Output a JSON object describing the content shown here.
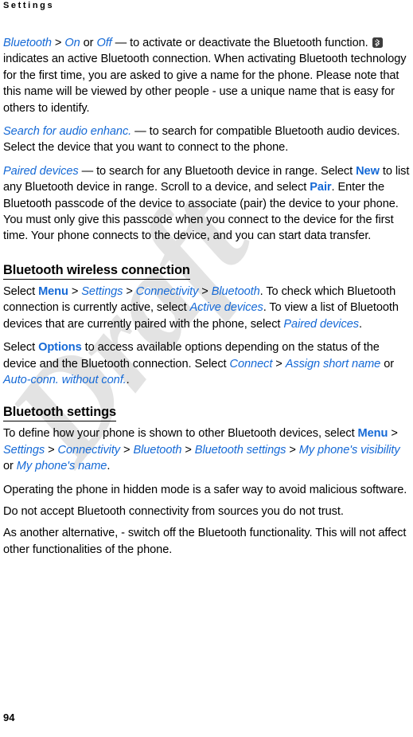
{
  "page": {
    "running_header": "Settings",
    "folio": "94",
    "watermark": "Draft",
    "accent_color": "#1569d6",
    "text_color": "#000000",
    "background_color": "#ffffff",
    "watermark_color": "#e3e3e3"
  },
  "content": {
    "para_bluetooth_onoff": {
      "term": "Bluetooth",
      "sep1": " > ",
      "opt_on": "On",
      "mid_or": " or ",
      "opt_off": "Off",
      "text_a": " — to activate or deactivate the Bluetooth function. ",
      "icon": "bluetooth-icon",
      "text_b": " indicates an active Bluetooth connection. When activating Bluetooth technology for the first time, you are asked to give a name for the phone. Please note that this name will be viewed by other people - use a unique name that is easy for others to identify."
    },
    "para_search_audio": {
      "term": "Search for audio enhanc.",
      "text": " — to search for compatible Bluetooth audio devices. Select the device that you want to connect to the phone."
    },
    "para_paired_devices": {
      "term": "Paired devices",
      "text_a": " — to search for any Bluetooth device in range. Select ",
      "btn_new": "New",
      "text_b": " to list any Bluetooth device in range. Scroll to a device, and select ",
      "btn_pair": "Pair",
      "text_c": ". Enter the Bluetooth passcode of the device to associate (pair) the device to your phone. You must only give this passcode when you connect to the device for the first time. Your phone connects to the device, and you can start data transfer."
    },
    "heading_wireless_connection": "Bluetooth wireless connection",
    "para_select_path": {
      "lead": "Select ",
      "menu": "Menu",
      "sep1": " > ",
      "settings": "Settings",
      "sep2": " > ",
      "connectivity": "Connectivity",
      "sep3": " > ",
      "bluetooth": "Bluetooth",
      "text_a": ". To check which Bluetooth connection is currently active, select ",
      "active_devices": "Active devices",
      "text_b": ". To view a list of Bluetooth devices that are currently paired with the phone, select ",
      "paired_devices": "Paired devices",
      "text_c": "."
    },
    "para_options": {
      "lead": "Select ",
      "options": "Options",
      "text_a": " to access available options depending on the status of the device and the Bluetooth connection. Select ",
      "connect": "Connect",
      "sep1": " > ",
      "assign_short_name": "Assign short name",
      "mid_or": " or ",
      "auto_conn": "Auto-conn. without conf.",
      "text_b": "."
    },
    "heading_bluetooth_settings": "Bluetooth settings",
    "para_visibility_path": {
      "lead": "To define how your phone is shown to other Bluetooth devices, select ",
      "menu": "Menu",
      "sep1": " > ",
      "settings": "Settings",
      "sep2": " > ",
      "connectivity": "Connectivity",
      "sep3": " > ",
      "bluetooth": "Bluetooth",
      "sep4": " > ",
      "bluetooth_settings": "Bluetooth settings",
      "sep5": " > ",
      "my_phones_visibility": "My phone's visibility",
      "mid_or": " or ",
      "my_phones_name": "My phone's name",
      "text_end": "."
    },
    "para_hidden_mode": "Operating the phone in hidden mode is a safer way to avoid malicious software.",
    "para_do_not_accept": "Do not accept Bluetooth connectivity from sources you do not trust.",
    "para_alternative": "As another alternative, - switch off the Bluetooth functionality.  This will not affect other functionalities of the phone."
  }
}
